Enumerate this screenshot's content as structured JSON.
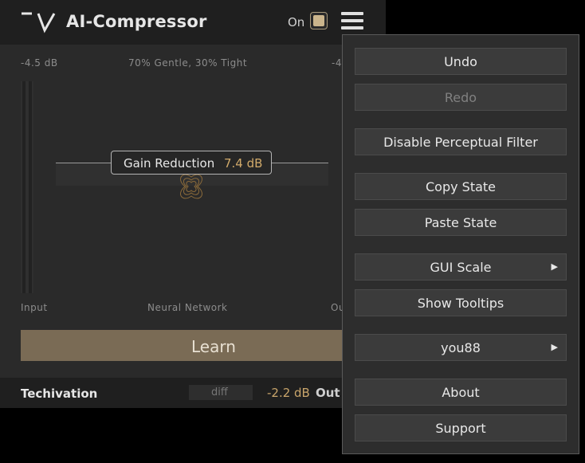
{
  "header": {
    "title": "AI-Compressor",
    "on_label": "On"
  },
  "labels": {
    "input_db": "-4.5 dB",
    "blend": "70% Gentle, 30% Tight",
    "output_db_partial": "-4.",
    "input": "Input",
    "neural_network": "Neural Network",
    "output_partial": "Ou"
  },
  "gain_reduction": {
    "label": "Gain Reduction",
    "value": "7.4 dB"
  },
  "learn_button": {
    "label": "Learn"
  },
  "footer": {
    "brand": "Techivation",
    "diff": "diff",
    "out_value": "-2.2 dB",
    "out_label": "Out"
  },
  "menu": {
    "items": [
      {
        "label": "Undo",
        "enabled": true
      },
      {
        "label": "Redo",
        "enabled": false
      },
      {
        "label": "Disable Perceptual Filter",
        "enabled": true
      },
      {
        "label": "Copy State",
        "enabled": true
      },
      {
        "label": "Paste State",
        "enabled": true
      },
      {
        "label": "GUI Scale",
        "enabled": true,
        "submenu": true
      },
      {
        "label": "Show Tooltips",
        "enabled": true
      },
      {
        "label": "you88",
        "enabled": true,
        "submenu": true
      },
      {
        "label": "About",
        "enabled": true
      },
      {
        "label": "Support",
        "enabled": true
      }
    ],
    "submenu_arrow": "▶"
  },
  "colors": {
    "accent": "#cbb58c",
    "value_gold": "#d1aa6a",
    "learn_bg": "#7a6b55"
  }
}
